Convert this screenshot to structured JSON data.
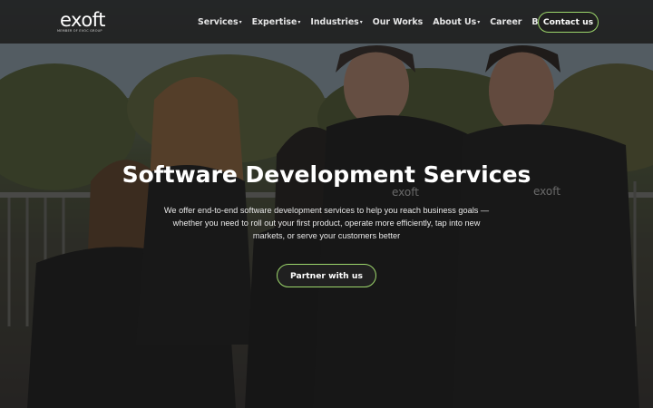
{
  "brand": {
    "logo_text": "exoft",
    "logo_subtext": "MEMBER OF EVOC GROUP",
    "accent_color": "#9cd66b"
  },
  "nav": {
    "items": [
      {
        "label": "Services",
        "has_dropdown": true
      },
      {
        "label": "Expertise",
        "has_dropdown": true
      },
      {
        "label": "Industries",
        "has_dropdown": true
      },
      {
        "label": "Our Works",
        "has_dropdown": false
      },
      {
        "label": "About Us",
        "has_dropdown": true
      },
      {
        "label": "Career",
        "has_dropdown": false
      },
      {
        "label": "Blog",
        "has_dropdown": false
      }
    ],
    "dropdown_glyph": "▾",
    "contact_label": "Contact us"
  },
  "hero": {
    "title": "Software Development Services",
    "description": "We offer end-to-end software development services to help you reach business goals — whether you need to roll out your first product, operate more efficiently, tap into new markets, or serve your customers better",
    "cta_label": "Partner with us",
    "shirt_logo_text": "exoft"
  }
}
